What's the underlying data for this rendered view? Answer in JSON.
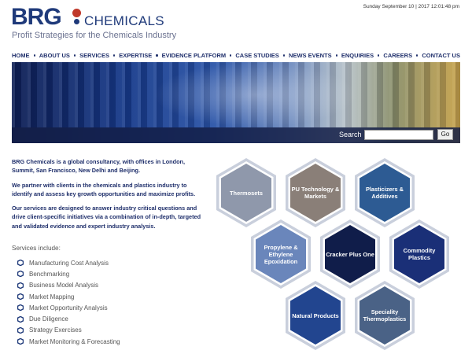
{
  "brand": {
    "logo_brg": "BRG",
    "logo_chemicals": "CHEMICALS",
    "tagline": "Profit Strategies for the Chemicals Industry"
  },
  "datetime": "Sunday September 10 | 2017 12:01:48 pm",
  "nav": [
    "HOME",
    "ABOUT US",
    "SERVICES",
    "EXPERTISE",
    "EVIDENCE PLATFORM",
    "CASE STUDIES",
    "NEWS EVENTS",
    "ENQUIRIES",
    "CAREERS",
    "CONTACT US"
  ],
  "search": {
    "label": "Search",
    "value": "",
    "placeholder": "",
    "button": "Go"
  },
  "intro": [
    "BRG Chemicals is a global consultancy, with offices in London, Summit, San Francisco, New Delhi and Beijing.",
    "We partner with clients in the chemicals and plastics industry to identify and assess key growth opportunities and maximize profits.",
    "Our services are designed to answer industry critical questions and drive client-specific initiatives via a combination of in-depth, targeted and validated evidence and expert industry analysis."
  ],
  "services_label": "Services include:",
  "services": [
    "Manufacturing Cost Analysis",
    "Benchmarking",
    "Business Model Analysis",
    "Market Mapping",
    "Market Opportunity Analysis",
    "Due Diligence",
    "Strategy Exercises",
    "Market Monitoring & Forecasting"
  ],
  "hexagons": [
    {
      "label": "Thermosets",
      "fill": "#8f98ab"
    },
    {
      "label": "PU Technology & Markets",
      "fill": "#8a7f78"
    },
    {
      "label": "Plasticizers & Additives",
      "fill": "#2d5b93"
    },
    {
      "label": "Propylene & Ethylene Epoxidation",
      "fill": "#6a86bb"
    },
    {
      "label": "Cracker Plus One",
      "fill": "#101d4a"
    },
    {
      "label": "Commodity Plastics",
      "fill": "#1a2f77"
    },
    {
      "label": "Natural Products",
      "fill": "#22458f"
    },
    {
      "label": "Speciality Thermoplastics",
      "fill": "#4a6286"
    }
  ],
  "colors": {
    "brand_navy": "#1f3a7a",
    "brand_red": "#c0392b",
    "text": "#1f2f6b"
  }
}
